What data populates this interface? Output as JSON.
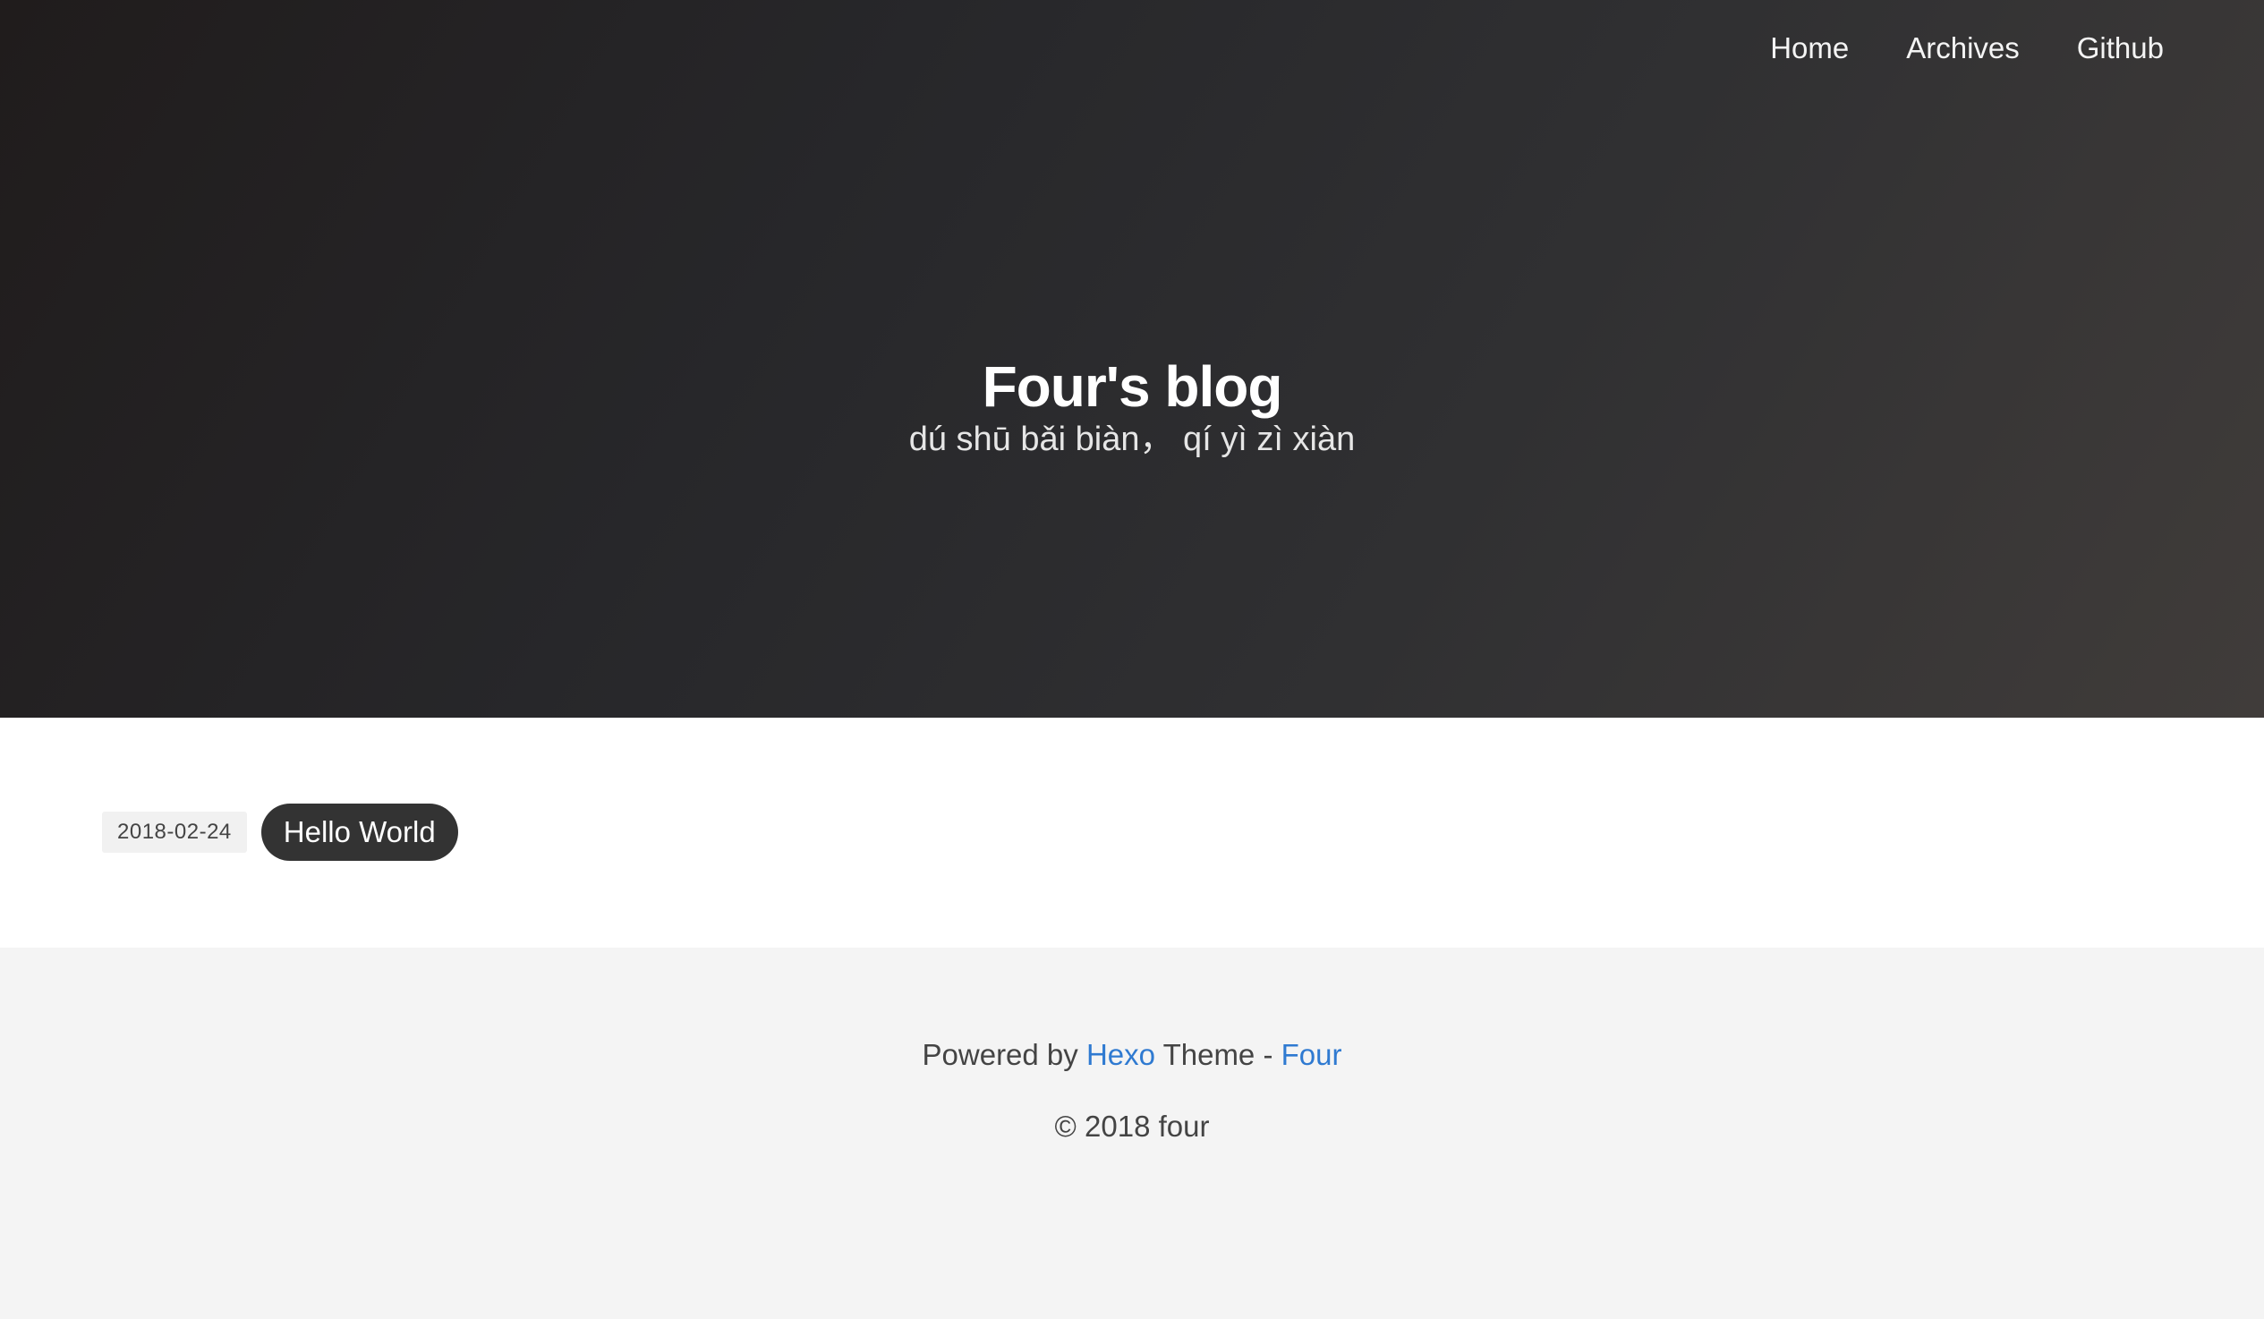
{
  "nav": {
    "items": [
      {
        "label": "Home"
      },
      {
        "label": "Archives"
      },
      {
        "label": "Github"
      }
    ]
  },
  "hero": {
    "title": "Four's blog",
    "subtitle": "dú shū bǎi biàn，  qí yì zì xiàn"
  },
  "posts": [
    {
      "date": "2018-02-24",
      "title": "Hello World"
    }
  ],
  "footer": {
    "powered_prefix": "Powered by",
    "hexo_link": "Hexo",
    "theme_text": "Theme -",
    "four_link": "Four",
    "copyright": "© 2018 four"
  },
  "colors": {
    "link": "#2f7ad1",
    "pill": "#333333",
    "footer_bg": "#f4f4f4"
  }
}
